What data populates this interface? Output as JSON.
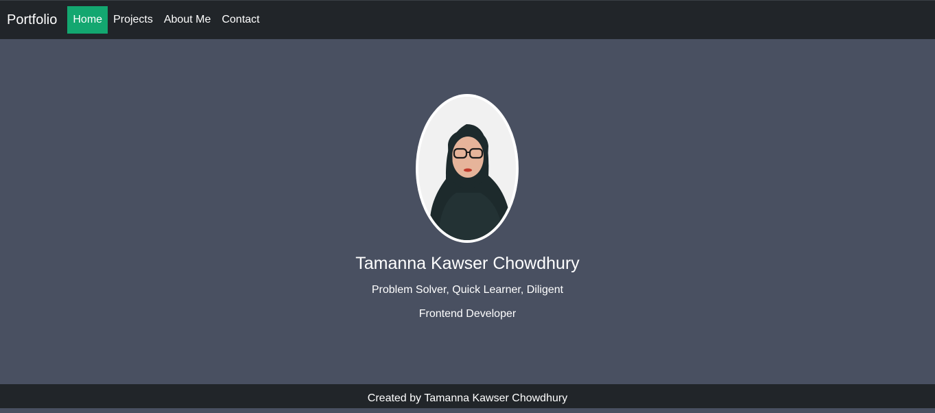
{
  "navbar": {
    "brand": "Portfolio",
    "links": [
      {
        "label": "Home",
        "active": true
      },
      {
        "label": "Projects",
        "active": false
      },
      {
        "label": "About Me",
        "active": false
      },
      {
        "label": "Contact",
        "active": false
      }
    ]
  },
  "hero": {
    "name": "Tamanna Kawser Chowdhury",
    "tagline": "Problem Solver, Quick Learner, Diligent",
    "role": "Frontend Developer"
  },
  "footer": {
    "text": "Created by Tamanna Kawser Chowdhury"
  },
  "colors": {
    "navbar_bg": "#212529",
    "page_bg": "#495061",
    "active_link_bg": "#13a770"
  }
}
